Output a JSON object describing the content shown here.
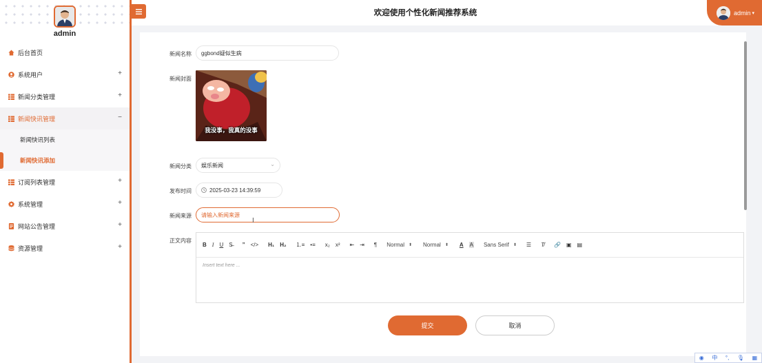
{
  "user": {
    "name": "admin"
  },
  "header": {
    "title": "欢迎使用个性化新闻推荐系统",
    "user_label": "admin"
  },
  "sidebar": {
    "items": [
      {
        "label": "后台首页",
        "icon": "home-icon",
        "expand": ""
      },
      {
        "label": "系统用户",
        "icon": "user-icon",
        "expand": "+"
      },
      {
        "label": "新闻分类管理",
        "icon": "grid-icon",
        "expand": "+"
      },
      {
        "label": "新闻快讯管理",
        "icon": "grid-icon",
        "expand": "−",
        "active": true
      },
      {
        "label": "订阅列表管理",
        "icon": "grid-icon",
        "expand": "+"
      },
      {
        "label": "系统管理",
        "icon": "gear-icon",
        "expand": "+"
      },
      {
        "label": "网站公告管理",
        "icon": "document-icon",
        "expand": "+"
      },
      {
        "label": "资源管理",
        "icon": "database-icon",
        "expand": "+"
      }
    ],
    "subitems": [
      {
        "label": "新闻快讯列表"
      },
      {
        "label": "新闻快讯添加",
        "active": true
      }
    ]
  },
  "form": {
    "title_label": "新闻名称",
    "title_value": "ggbond疑似生病",
    "cover_label": "新闻封面",
    "cover_caption": "我没事，我真的没事",
    "category_label": "新闻分类",
    "category_value": "娱乐新闻",
    "time_label": "发布时间",
    "time_value": "2025-03-23 14:39:59",
    "source_label": "新闻来源",
    "source_placeholder": "请输入新闻来源",
    "content_label": "正文内容"
  },
  "editor": {
    "heading_select": "Normal",
    "size_select": "Normal",
    "font_select": "Sans Serif",
    "placeholder": "Insert text here ...",
    "h1": "H₁",
    "h2": "H₂"
  },
  "buttons": {
    "submit": "提交",
    "cancel": "取消"
  },
  "ime_bar": {
    "lang": "中"
  },
  "colors": {
    "accent": "#e06a32",
    "background": "#f2f3f6"
  }
}
